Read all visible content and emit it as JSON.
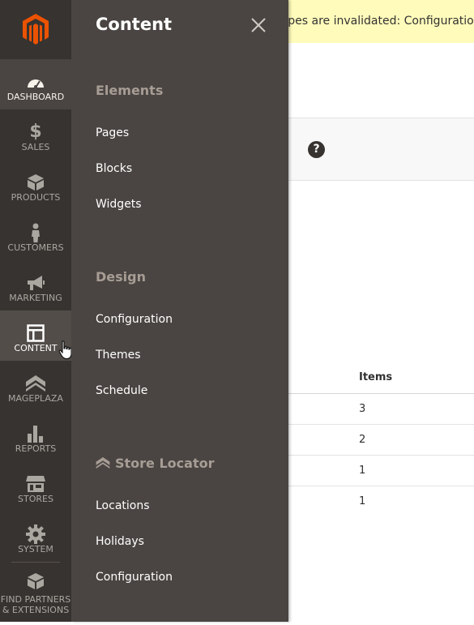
{
  "notification": {
    "text": "ypes are invalidated: Configuration,"
  },
  "grid": {
    "header": "Items",
    "rows": [
      "3",
      "2",
      "1",
      "1"
    ]
  },
  "menu": {
    "items": [
      {
        "label": "DASHBOARD",
        "icon": "dashboard-icon"
      },
      {
        "label": "SALES",
        "icon": "dollar-icon"
      },
      {
        "label": "PRODUCTS",
        "icon": "cube-icon"
      },
      {
        "label": "CUSTOMERS",
        "icon": "person-icon"
      },
      {
        "label": "MARKETING",
        "icon": "megaphone-icon"
      },
      {
        "label": "CONTENT",
        "icon": "layout-icon"
      },
      {
        "label": "MAGEPLAZA",
        "icon": "mageplaza-icon"
      },
      {
        "label": "REPORTS",
        "icon": "bar-chart-icon"
      },
      {
        "label": "STORES",
        "icon": "store-icon"
      },
      {
        "label": "SYSTEM",
        "icon": "gear-icon"
      }
    ],
    "partners_line1": "FIND PARTNERS",
    "partners_line2": "& EXTENSIONS"
  },
  "submenu": {
    "title": "Content",
    "groups": [
      {
        "title": "Elements",
        "links": [
          "Pages",
          "Blocks",
          "Widgets"
        ]
      },
      {
        "title": "Design",
        "links": [
          "Configuration",
          "Themes",
          "Schedule"
        ]
      },
      {
        "title": "Store Locator",
        "links": [
          "Locations",
          "Holidays",
          "Configuration"
        ]
      }
    ]
  },
  "colors": {
    "menu_bg": "#373330",
    "submenu_bg": "#4a4542",
    "notice_bg": "#fffbbb",
    "brand": "#eb5202"
  }
}
